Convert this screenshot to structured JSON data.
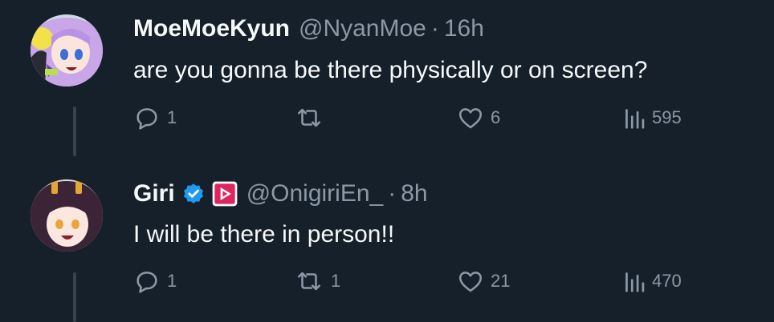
{
  "colors": {
    "background": "#15202b",
    "text_primary": "#f7f9f9",
    "text_secondary": "#8b98a5",
    "thread_line": "#38444d",
    "verified_blue": "#1d9bf0",
    "affiliate_red": "#e0245e"
  },
  "tweets": [
    {
      "avatar_icon": "anime-avatar-lilac-hair",
      "display_name": "MoeMoeKyun",
      "handle": "@NyanMoe",
      "separator": "·",
      "time": "16h",
      "text": "are you gonna be there physically or on screen?",
      "replies": "1",
      "retweets": "",
      "likes": "6",
      "views": "595"
    },
    {
      "avatar_icon": "anime-avatar-dark-hair",
      "display_name": "Giri",
      "verified_icon": "verified-check-icon",
      "affiliate_icon": "affiliate-badge-icon",
      "handle": "@OnigiriEn_",
      "separator": "·",
      "time": "8h",
      "text": "I will be there in person!!",
      "replies": "1",
      "retweets": "1",
      "likes": "21",
      "views": "470"
    }
  ]
}
